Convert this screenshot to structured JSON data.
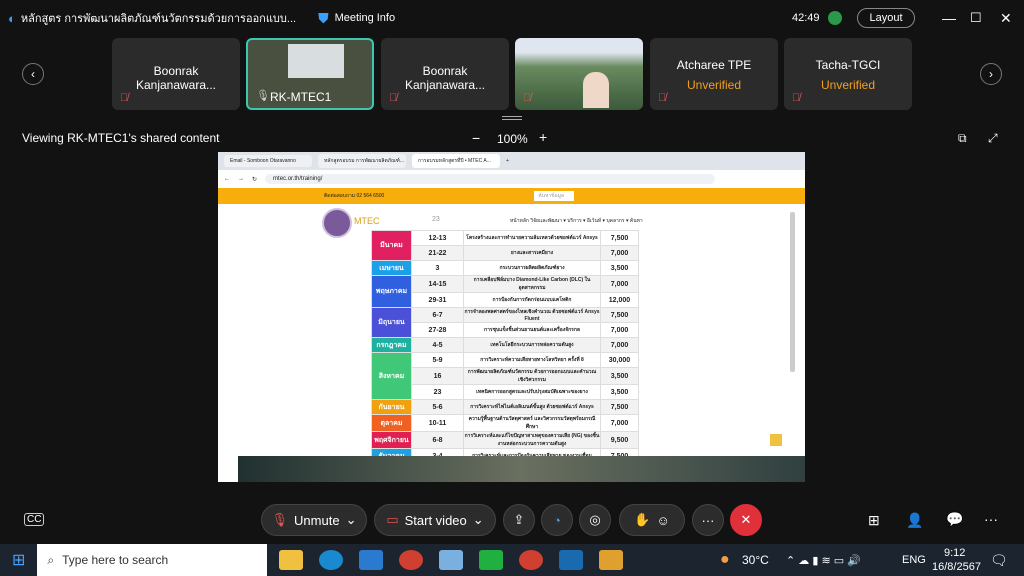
{
  "app": {
    "title": "หลักสูตร การพัฒนาผลิตภัณฑ์นวัตกรรมด้วยการออกแบบ...",
    "meeting_info": "Meeting Info",
    "timer": "42:49",
    "layout": "Layout"
  },
  "participants": [
    {
      "name": "Boonrak Kanjanawara...",
      "status": ""
    },
    {
      "name": "RK-MTEC1",
      "status": ""
    },
    {
      "name": "Boonrak Kanjanawara...",
      "status": ""
    },
    {
      "name": "",
      "status": ""
    },
    {
      "name": "Atcharee TPE",
      "status": "Unverified"
    },
    {
      "name": "Tacha-TGCI",
      "status": "Unverified"
    }
  ],
  "share": {
    "viewing": "Viewing RK-MTEC1's shared content",
    "zoom": "100%",
    "minus": "−",
    "plus": "+"
  },
  "browser": {
    "tabs": [
      "Email - Somboon Otaravanno",
      "หลักสูตรอบรม การพัฒนาผลิตภัณฑ์...",
      "การอบรมหลักสูตรที่ปี • MTEC A..."
    ],
    "url": "mtec.or.th/training/",
    "phone": "ติดต่อสอบถาม 02 564 6500",
    "search_placeholder": "ค้นหาข้อมูล",
    "nav": "หน้าหลัก  วิจัยและพัฒนา ▾  บริการ ▾  อีเว้นท์ ▾  บุคลากร ▾  ค้นหา",
    "logo": "MTEC",
    "header_num": "23"
  },
  "schedule": [
    {
      "month": "มีนาคม",
      "color": "#e02060",
      "rows": [
        [
          "12-13",
          "โครงสร้างและการทำนายความล้มเหลวด้วยซอฟต์แวร์ Ansys",
          "7,500"
        ],
        [
          "21-22",
          "ยางและสารเคมียาง",
          "7,000"
        ]
      ]
    },
    {
      "month": "เมษายน",
      "color": "#1ca0e8",
      "rows": [
        [
          "3",
          "กระบวนการผลิตผลิตภัณฑ์ยาง",
          "3,500"
        ]
      ]
    },
    {
      "month": "พฤษภาคม",
      "color": "#3060e0",
      "rows": [
        [
          "14-15",
          "การเคลือบฟิล์มบาง Diamond-Like Carbon (DLC) ในอุตสาหกรรม",
          "7,000"
        ],
        [
          "29-31",
          "การป้องกันการกัดกร่อนแบบแคโทดิก",
          "12,000"
        ]
      ]
    },
    {
      "month": "มิถุนายน",
      "color": "#4a50d8",
      "rows": [
        [
          "6-7",
          "การจำลองพลศาสตร์ของไหลเชิงคำนวณ ด้วยซอฟต์แวร์ Ansys Fluent",
          "7,500"
        ],
        [
          "27-28",
          "การชุบแข็งชิ้นส่วนยานยนต์และเครื่องจักรกล",
          "7,000"
        ]
      ]
    },
    {
      "month": "กรกฎาคม",
      "color": "#20b0a0",
      "rows": [
        [
          "4-5",
          "เทคโนโลยีกระบวนการหล่อความดันสูง",
          "7,000"
        ]
      ]
    },
    {
      "month": "สิงหาคม",
      "color": "#40c878",
      "rows": [
        [
          "5-9",
          "การวิเคราะห์ความเสียหายทางโลหวิทยา ครั้งที่ 8",
          "30,000"
        ],
        [
          "16",
          "การพัฒนาผลิตภัณฑ์นวัตกรรม ด้วยการออกแบบและคำนวณเชิงวิศวกรรม",
          "3,500"
        ],
        [
          "23",
          "เทคนิคการออกสูตรและปรับปรุงสมบัติเฉพาะของยาง",
          "3,500"
        ]
      ]
    },
    {
      "month": "กันยายน",
      "color": "#f0a010",
      "rows": [
        [
          "5-6",
          "การวิเคราะห์ไฟไนต์เอลิเมนต์ขั้นสูง ด้วยซอฟต์แวร์ Ansys",
          "7,500"
        ]
      ]
    },
    {
      "month": "ตุลาคม",
      "color": "#f06020",
      "rows": [
        [
          "10-11",
          "ความรู้พื้นฐานด้านวัสดุศาสตร์ และวิศวกรรมวัสดุพร้อมกรณีศึกษา",
          "7,000"
        ]
      ]
    },
    {
      "month": "พฤศจิกายน",
      "color": "#e02050",
      "rows": [
        [
          "6-8",
          "การวิเคราะห์และแก้ไขปัญหาสาเหตุของความเสีย (NG) ของชิ้นงานหล่อกระบวนการความดันสูง",
          "9,500"
        ]
      ]
    },
    {
      "month": "ธันวาคม",
      "color": "#20a0e0",
      "rows": [
        [
          "3-4",
          "การวิเคราะห์และการป้องกันความเสียหาย ของงานเชื่อม",
          "7,500"
        ]
      ]
    }
  ],
  "controls": {
    "unmute": "Unmute",
    "start_video": "Start video",
    "cc": "CC",
    "end": "✕"
  },
  "taskbar": {
    "search_placeholder": "Type here to search",
    "weather": "30°C",
    "lang": "ENG",
    "time": "9:12",
    "date": "16/8/2567"
  }
}
